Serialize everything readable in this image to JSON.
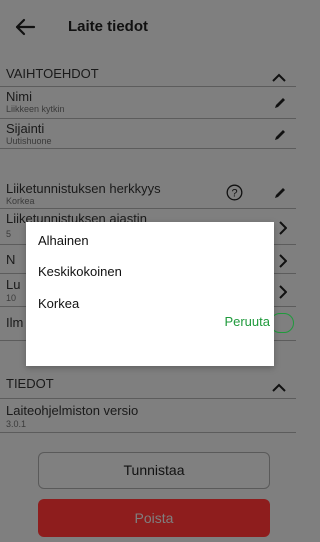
{
  "header": {
    "title": "Laite tiedot"
  },
  "options_section": {
    "heading": "VAIHTOEHDOT",
    "rows": [
      {
        "title": "Nimi",
        "value": "Liikkeen kytkin"
      },
      {
        "title": "Sijainti",
        "value": "Uutishuone"
      },
      {
        "title": "Liiketunnistuksen herkkyys",
        "value": "Korkea"
      },
      {
        "title": "Liiketunnistuksen ajastin",
        "value": "5"
      },
      {
        "title": "N"
      },
      {
        "title": "Lu",
        "value": "10"
      },
      {
        "title": "Ilm"
      }
    ]
  },
  "dialog": {
    "options": [
      "Alhainen",
      "Keskikokoinen",
      "Korkea"
    ],
    "cancel_label": "Peruuta"
  },
  "info_section": {
    "heading": "TIEDOT",
    "rows": [
      {
        "title": "Laiteohjelmiston versio",
        "value": "3.0.1"
      }
    ]
  },
  "buttons": {
    "identify_label": "Tunnistaa",
    "delete_label": "Poista"
  },
  "colors": {
    "accent_green": "#1f9a3c",
    "danger_red": "#8e1d1d"
  }
}
